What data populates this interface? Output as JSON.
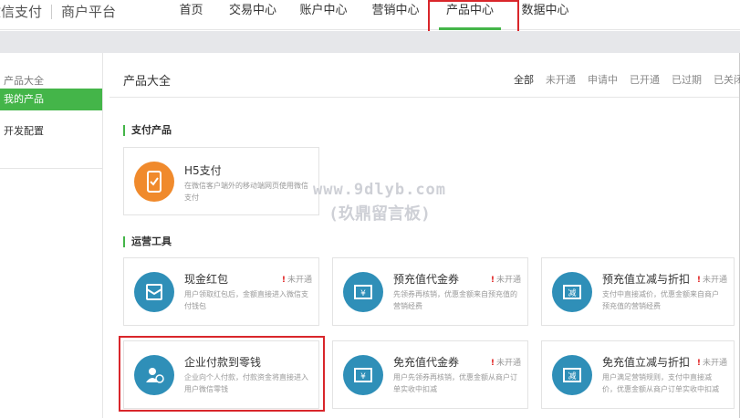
{
  "brand": {
    "name": "微信支付",
    "platform": "商户平台"
  },
  "nav": {
    "items": [
      {
        "id": "home",
        "label": "首页"
      },
      {
        "id": "trade",
        "label": "交易中心"
      },
      {
        "id": "account",
        "label": "账户中心"
      },
      {
        "id": "marketing",
        "label": "营销中心"
      },
      {
        "id": "product",
        "label": "产品中心",
        "active": true
      },
      {
        "id": "data",
        "label": "数据中心"
      }
    ]
  },
  "sidebar": {
    "group_label": "产品大全",
    "active_item": "我的产品",
    "items": [
      "开发配置"
    ]
  },
  "main": {
    "title": "产品大全",
    "filters": [
      "全部",
      "未开通",
      "申请中",
      "已开通",
      "已过期",
      "已关闭"
    ],
    "sections": {
      "payment": {
        "title": "支付产品",
        "cards": [
          {
            "title": "H5支付",
            "desc": "在微信客户端外的移动端网页使用微信支付",
            "icon": "phone-icon",
            "color": "#f08a2c"
          }
        ]
      },
      "tools": {
        "title": "运营工具",
        "cards": [
          {
            "title": "现金红包",
            "desc": "用户领取红包后，金额直接进入微信支付钱包",
            "status": "未开通",
            "icon": "red-packet-icon"
          },
          {
            "title": "预充值代金券",
            "desc": "先领券再核销，优惠金额来自预充值的营销经费",
            "status": "未开通",
            "icon": "voucher-icon"
          },
          {
            "title": "预充值立减与折扣",
            "desc": "支付中直接减价，优惠金额来自商户预充值的营销经费",
            "status": "未开通",
            "icon": "discount-icon"
          },
          {
            "title": "企业付款到零钱",
            "desc": "企业向个人付款，付款资金将直接进入用户微信零钱",
            "icon": "enterprise-pay-icon"
          },
          {
            "title": "免充值代金券",
            "desc": "用户先领券再核销，优惠金额从商户订单实收中扣减",
            "status": "未开通",
            "icon": "voucher-icon"
          },
          {
            "title": "免充值立减与折扣",
            "desc": "用户满足营销规则，支付中直接减价，优惠金额从商户订单实收中扣减",
            "status": "未开通",
            "icon": "discount-icon"
          }
        ]
      }
    },
    "status_mark": "!",
    "tool_icon_color": "#2f8fb8",
    "accent": "#44b549",
    "highlight": "#d9262b"
  },
  "watermark": {
    "line1": "www.9dlyb.com",
    "line2": "(玖鼎留言板)"
  }
}
